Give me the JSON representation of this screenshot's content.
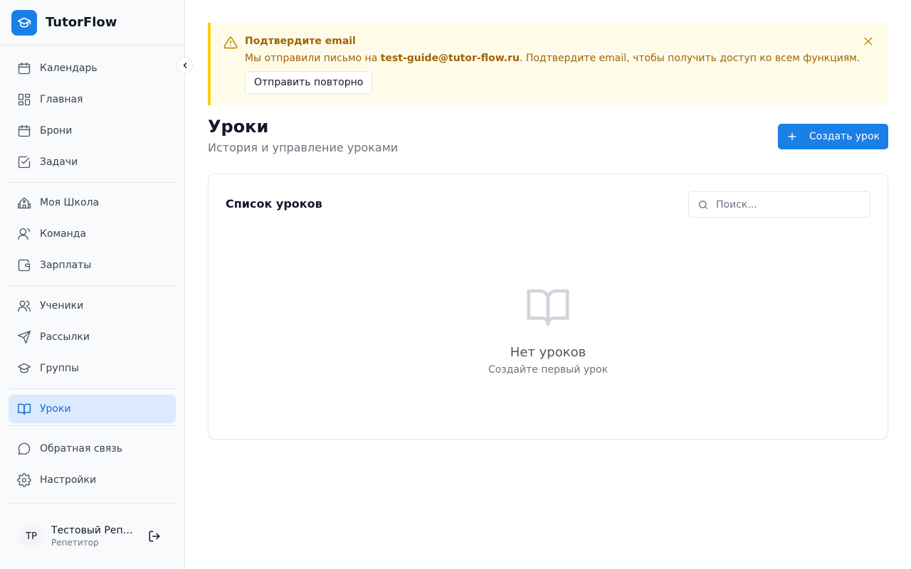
{
  "app": {
    "name": "TutorFlow"
  },
  "sidebar": {
    "items": [
      {
        "label": "Календарь"
      },
      {
        "label": "Главная"
      },
      {
        "label": "Брони"
      },
      {
        "label": "Задачи"
      },
      {
        "label": "Моя Школа"
      },
      {
        "label": "Команда"
      },
      {
        "label": "Зарплаты"
      },
      {
        "label": "Ученики"
      },
      {
        "label": "Рассылки"
      },
      {
        "label": "Группы"
      },
      {
        "label": "Уроки",
        "active": true
      },
      {
        "label": "Обратная связь"
      },
      {
        "label": "Настройки"
      }
    ],
    "user": {
      "initials": "TP",
      "name": "Тестовый Репетитор",
      "role": "Репетитор"
    }
  },
  "banner": {
    "title": "Подтвердите email",
    "text_before": "Мы отправили письмо на ",
    "email": "test-guide@tutor-flow.ru",
    "text_after": ". Подтвердите email, чтобы получить доступ ко всем функциям.",
    "resend_label": "Отправить повторно"
  },
  "page": {
    "title": "Уроки",
    "subtitle": "История и управление уроками",
    "create_label": "Создать урок"
  },
  "card": {
    "title": "Список уроков",
    "search_placeholder": "Поиск...",
    "empty_title": "Нет уроков",
    "empty_subtitle": "Создайте первый урок"
  },
  "colors": {
    "accent": "#1a7fe6",
    "warning_text": "#a16207",
    "warning_bg": "#fefce8",
    "warning_border": "#facc15",
    "active_bg": "#dbeafe"
  }
}
